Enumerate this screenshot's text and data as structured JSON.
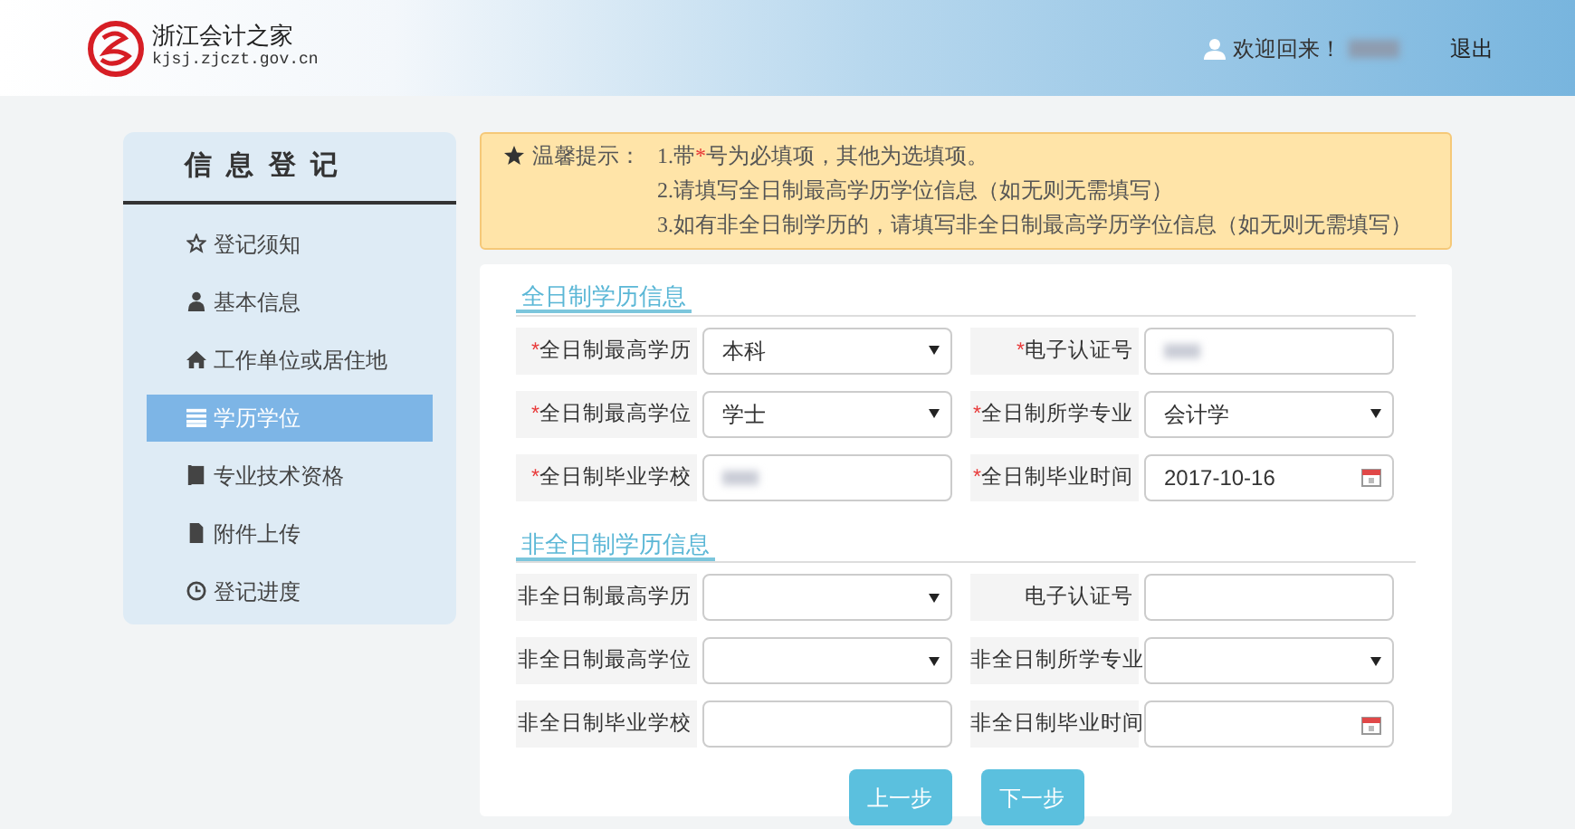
{
  "header": {
    "site_name": "浙江会计之家",
    "site_url": "kjsj.zjczt.gov.cn",
    "welcome": "欢迎回来！",
    "logout": "退出"
  },
  "sidebar": {
    "title": "信 息 登 记",
    "items": [
      {
        "label": "登记须知",
        "selected": false
      },
      {
        "label": "基本信息",
        "selected": false
      },
      {
        "label": "工作单位或居住地",
        "selected": false
      },
      {
        "label": "学历学位",
        "selected": true
      },
      {
        "label": "专业技术资格",
        "selected": false
      },
      {
        "label": "附件上传",
        "selected": false
      },
      {
        "label": "登记进度",
        "selected": false
      }
    ]
  },
  "notice": {
    "title": "温馨提示：",
    "lines": [
      {
        "before": "1.带",
        "mark": "*",
        "after": "号为必填项，其他为选填项。"
      },
      {
        "before": "2.请填写全日制最高学历学位信息（如无则无需填写）"
      },
      {
        "before": "3.如有非全日制学历的，请填写非全日制最高学历学位信息（如无则无需填写）"
      }
    ]
  },
  "sections": [
    {
      "title": "全日制学历信息",
      "fields": [
        {
          "label": "全日制最高学历",
          "required": true,
          "kind": "select",
          "value": "本科"
        },
        {
          "label": "电子认证号",
          "required": true,
          "kind": "masked"
        },
        {
          "label": "全日制最高学位",
          "required": true,
          "kind": "select",
          "value": "学士"
        },
        {
          "label": "全日制所学专业",
          "required": true,
          "kind": "select",
          "value": "会计学"
        },
        {
          "label": "全日制毕业学校",
          "required": true,
          "kind": "masked"
        },
        {
          "label": "全日制毕业时间",
          "required": true,
          "kind": "date",
          "value": "2017-10-16"
        }
      ]
    },
    {
      "title": "非全日制学历信息",
      "fields": [
        {
          "label": "非全日制最高学历",
          "required": false,
          "kind": "select"
        },
        {
          "label": "电子认证号",
          "required": false,
          "kind": "text"
        },
        {
          "label": "非全日制最高学位",
          "required": false,
          "kind": "select"
        },
        {
          "label": "非全日制所学专业",
          "required": false,
          "kind": "select"
        },
        {
          "label": "非全日制毕业学校",
          "required": false,
          "kind": "text"
        },
        {
          "label": "非全日制毕业时间",
          "required": false,
          "kind": "date"
        }
      ]
    }
  ],
  "buttons": [
    "上一步",
    "下一步"
  ]
}
